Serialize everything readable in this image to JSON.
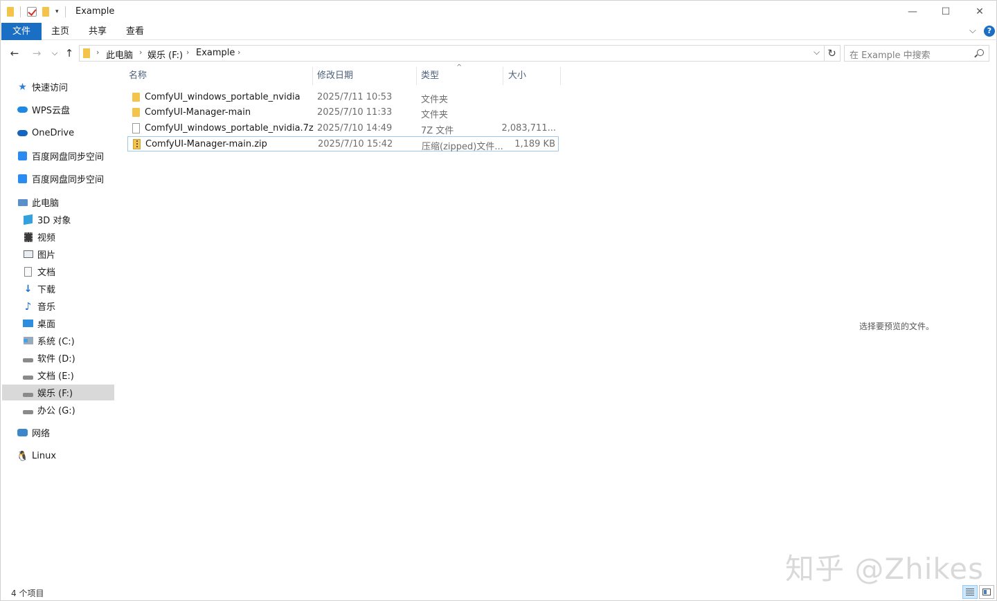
{
  "window": {
    "title": "Example"
  },
  "window_controls": {
    "minimize": "—",
    "maximize": "☐",
    "close": "✕"
  },
  "ribbon": {
    "tabs": [
      {
        "label": "文件"
      },
      {
        "label": "主页"
      },
      {
        "label": "共享"
      },
      {
        "label": "查看"
      }
    ],
    "expand_icon": "⌵",
    "help": "?"
  },
  "address": {
    "crumbs": [
      "此电脑",
      "娱乐 (F:)",
      "Example"
    ],
    "search_placeholder": "在 Example 中搜索"
  },
  "nav": {
    "items": [
      {
        "label": "快速访问",
        "icon": "star-icon"
      },
      {
        "label": "WPS云盘",
        "icon": "cloud-icon"
      },
      {
        "label": "OneDrive",
        "icon": "onedrive-icon"
      },
      {
        "label": "百度网盘同步空间",
        "icon": "baidu-icon"
      },
      {
        "label": "百度网盘同步空间",
        "icon": "baidu-icon"
      },
      {
        "label": "此电脑",
        "icon": "computer-icon"
      },
      {
        "label": "3D 对象",
        "icon": "cube-icon"
      },
      {
        "label": "视频",
        "icon": "video-icon"
      },
      {
        "label": "图片",
        "icon": "picture-icon"
      },
      {
        "label": "文档",
        "icon": "document-icon"
      },
      {
        "label": "下载",
        "icon": "download-icon"
      },
      {
        "label": "音乐",
        "icon": "music-icon"
      },
      {
        "label": "桌面",
        "icon": "desktop-icon"
      },
      {
        "label": "系统 (C:)",
        "icon": "windows-drive-icon"
      },
      {
        "label": "软件 (D:)",
        "icon": "drive-icon"
      },
      {
        "label": "文档 (E:)",
        "icon": "drive-icon"
      },
      {
        "label": "娱乐 (F:)",
        "icon": "drive-icon",
        "selected": true
      },
      {
        "label": "办公 (G:)",
        "icon": "drive-icon"
      },
      {
        "label": "网络",
        "icon": "network-icon"
      },
      {
        "label": "Linux",
        "icon": "linux-icon"
      }
    ]
  },
  "files": {
    "columns": {
      "name": "名称",
      "date": "修改日期",
      "type": "类型",
      "size": "大小"
    },
    "sort_indicator": "^",
    "rows": [
      {
        "name": "ComfyUI_windows_portable_nvidia",
        "date": "2025/7/11 10:53",
        "type": "文件夹",
        "size": "",
        "icon": "folder-icon"
      },
      {
        "name": "ComfyUI-Manager-main",
        "date": "2025/7/10 11:33",
        "type": "文件夹",
        "size": "",
        "icon": "folder-icon"
      },
      {
        "name": "ComfyUI_windows_portable_nvidia.7z",
        "date": "2025/7/10 14:49",
        "type": "7Z 文件",
        "size": "2,083,711...",
        "icon": "file-icon"
      },
      {
        "name": "ComfyUI-Manager-main.zip",
        "date": "2025/7/10 15:42",
        "type": "压缩(zipped)文件...",
        "size": "1,189 KB",
        "icon": "zip-icon",
        "selected": true
      }
    ]
  },
  "preview": {
    "text": "选择要预览的文件。"
  },
  "status": {
    "count": "4 个项目"
  },
  "watermark": {
    "text": "知乎 @Zhikes"
  }
}
